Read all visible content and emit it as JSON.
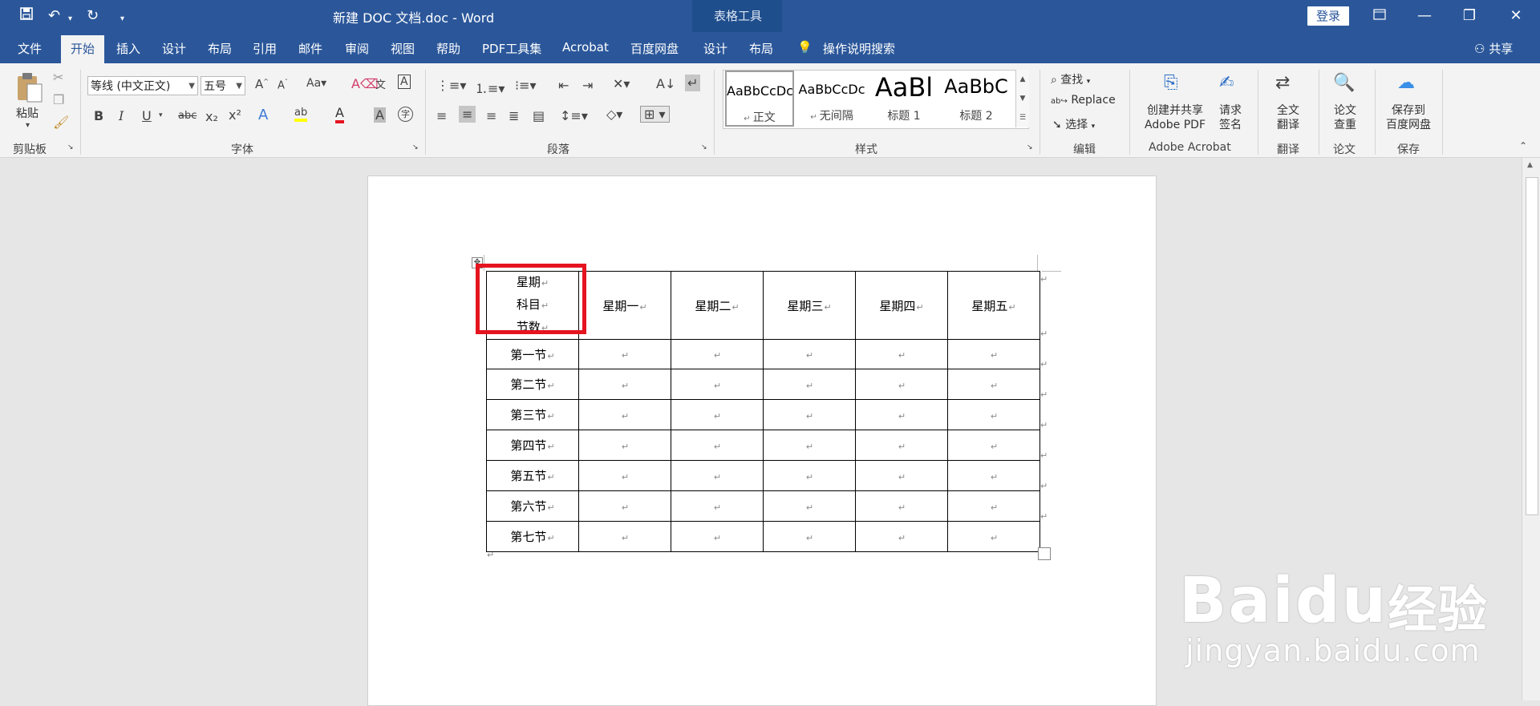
{
  "window": {
    "title": "新建 DOC 文档.doc  -  Word",
    "context_title": "表格工具",
    "login_label": "登录",
    "share_label": "共享",
    "qat": {
      "save_icon": "save-icon",
      "undo_icon": "undo-icon",
      "redo_icon": "redo-icon",
      "customize_icon": "customize-qat-icon"
    }
  },
  "tabs": [
    "文件",
    "开始",
    "插入",
    "设计",
    "布局",
    "引用",
    "邮件",
    "审阅",
    "视图",
    "帮助",
    "PDF工具集",
    "Acrobat",
    "百度网盘",
    "设计",
    "布局"
  ],
  "tell_me": "操作说明搜索",
  "ribbon": {
    "clipboard": {
      "paste": "粘贴",
      "label": "剪贴板"
    },
    "font": {
      "name": "等线 (中文正文)",
      "size": "五号",
      "label": "字体",
      "buttons": [
        "B",
        "I",
        "U",
        "abc",
        "x₂",
        "x²"
      ]
    },
    "paragraph": {
      "label": "段落"
    },
    "styles": {
      "label": "样式",
      "items": [
        {
          "preview": "AaBbCcDc",
          "name": "正文"
        },
        {
          "preview": "AaBbCcDc",
          "name": "无间隔"
        },
        {
          "preview": "AaBl",
          "name": "标题 1"
        },
        {
          "preview": "AaBbC",
          "name": "标题 2"
        }
      ]
    },
    "editing": {
      "label": "编辑",
      "find": "查找",
      "replace": "Replace",
      "select": "选择"
    },
    "acrobat": {
      "label": "Adobe Acrobat",
      "create_line1": "创建并共享",
      "create_line2": "Adobe PDF",
      "sign_line1": "请求",
      "sign_line2": "签名"
    },
    "translate": {
      "label": "翻译",
      "line1": "全文",
      "line2": "翻译"
    },
    "paper": {
      "label": "论文",
      "line1": "论文",
      "line2": "查重"
    },
    "save": {
      "label": "保存",
      "line1": "保存到",
      "line2": "百度网盘"
    }
  },
  "table": {
    "corner": [
      "星期",
      "科目",
      "节数"
    ],
    "headers": [
      "星期一",
      "星期二",
      "星期三",
      "星期四",
      "星期五"
    ],
    "rows": [
      "第一节",
      "第二节",
      "第三节",
      "第四节",
      "第五节",
      "第六节",
      "第七节"
    ]
  },
  "paragraph_mark": "↵",
  "watermark": {
    "brand": "Baidu",
    "cn": "经验",
    "url": "jingyan.baidu.com"
  },
  "colors": {
    "title_bar": "#2b579a",
    "highlight": "#e5141f"
  }
}
